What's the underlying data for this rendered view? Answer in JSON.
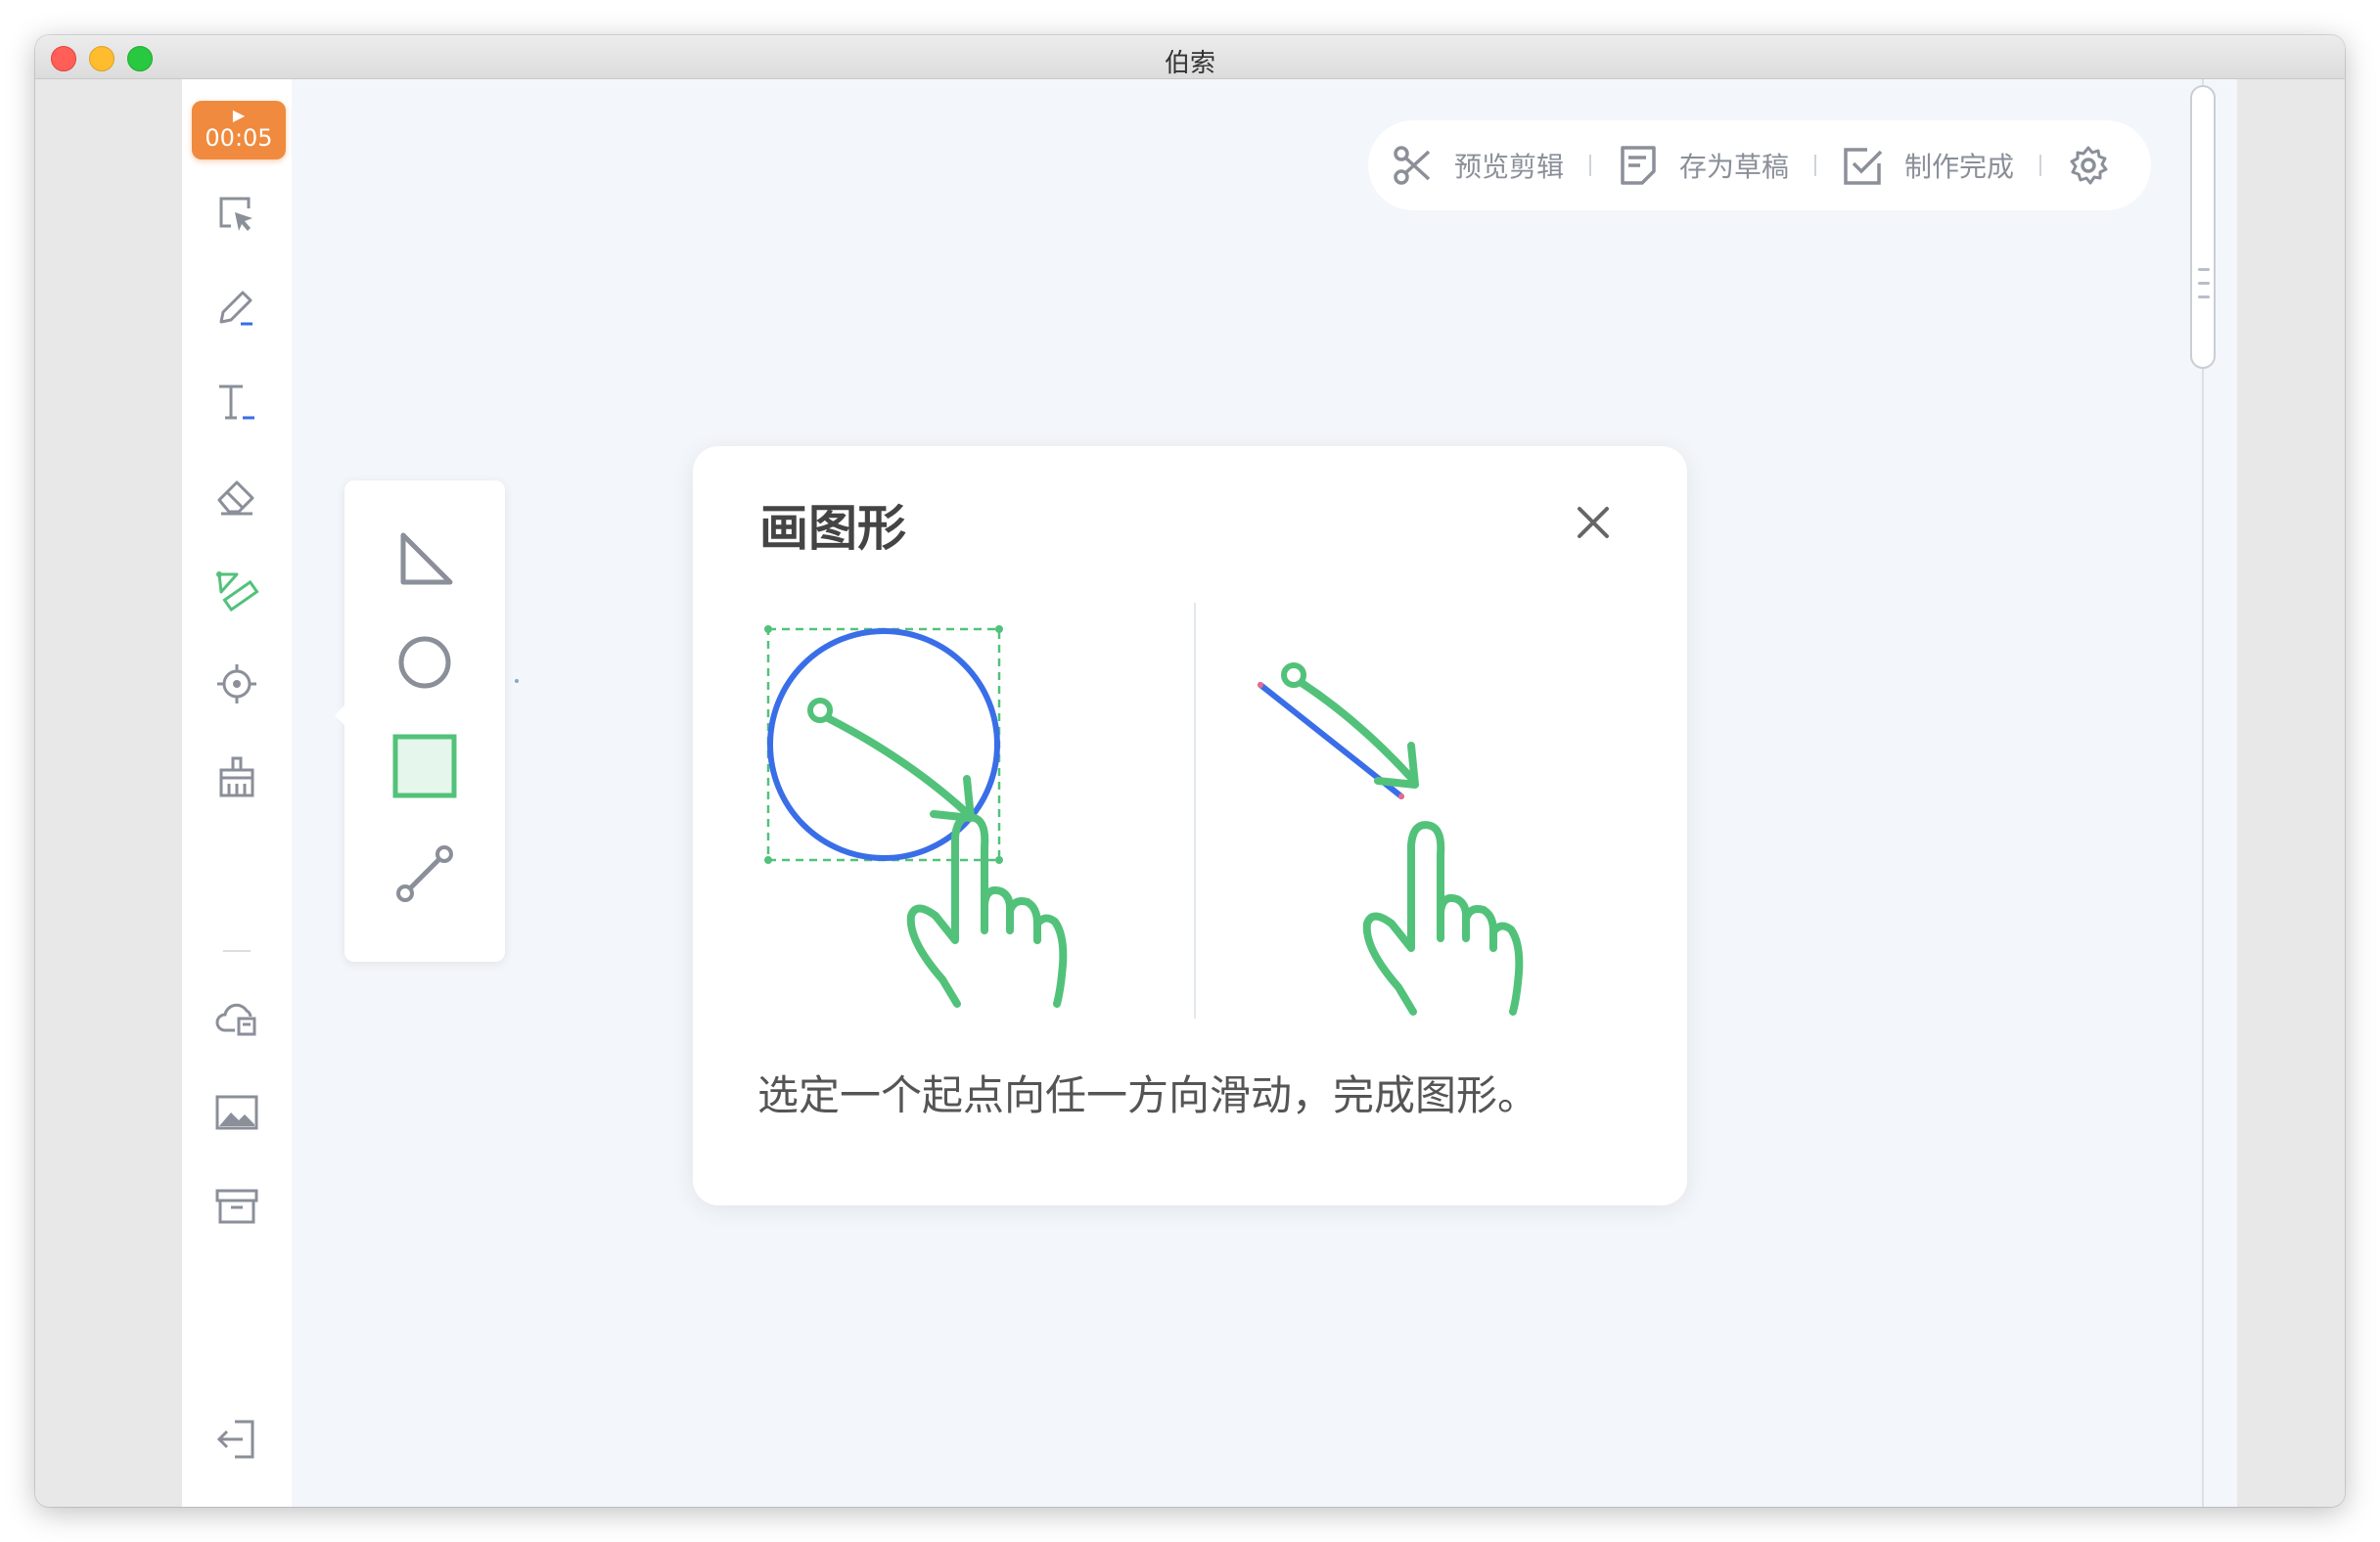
{
  "window": {
    "title": "伯索"
  },
  "sidebar": {
    "timer": {
      "play_glyph": "▶",
      "time": "00:05"
    },
    "tools": [
      {
        "icon": "select-icon"
      },
      {
        "icon": "pen-icon"
      },
      {
        "icon": "text-icon"
      },
      {
        "icon": "eraser-icon"
      },
      {
        "icon": "shape-ruler-icon",
        "active": true
      },
      {
        "icon": "laser-pointer-icon"
      },
      {
        "icon": "clear-broom-icon"
      },
      {
        "icon": "cloud-file-icon"
      },
      {
        "icon": "image-icon"
      },
      {
        "icon": "courseware-box-icon"
      },
      {
        "icon": "exit-icon"
      }
    ]
  },
  "shape_popup": {
    "items": [
      {
        "icon": "triangle-icon"
      },
      {
        "icon": "circle-icon"
      },
      {
        "icon": "rectangle-icon",
        "selected": true
      },
      {
        "icon": "line-icon"
      }
    ]
  },
  "toolbar": {
    "preview_edit": "预览剪辑",
    "save_draft": "存为草稿",
    "finish": "制作完成",
    "settings_icon": "gear-icon"
  },
  "dialog": {
    "title": "画图形",
    "description": "选定一个起点向任一方向滑动，完成图形。"
  },
  "colors": {
    "accent_green": "#52c27a",
    "shape_blue": "#3a6ee8",
    "timer_orange": "#f08a3e",
    "icon_gray": "#8a8f99"
  }
}
